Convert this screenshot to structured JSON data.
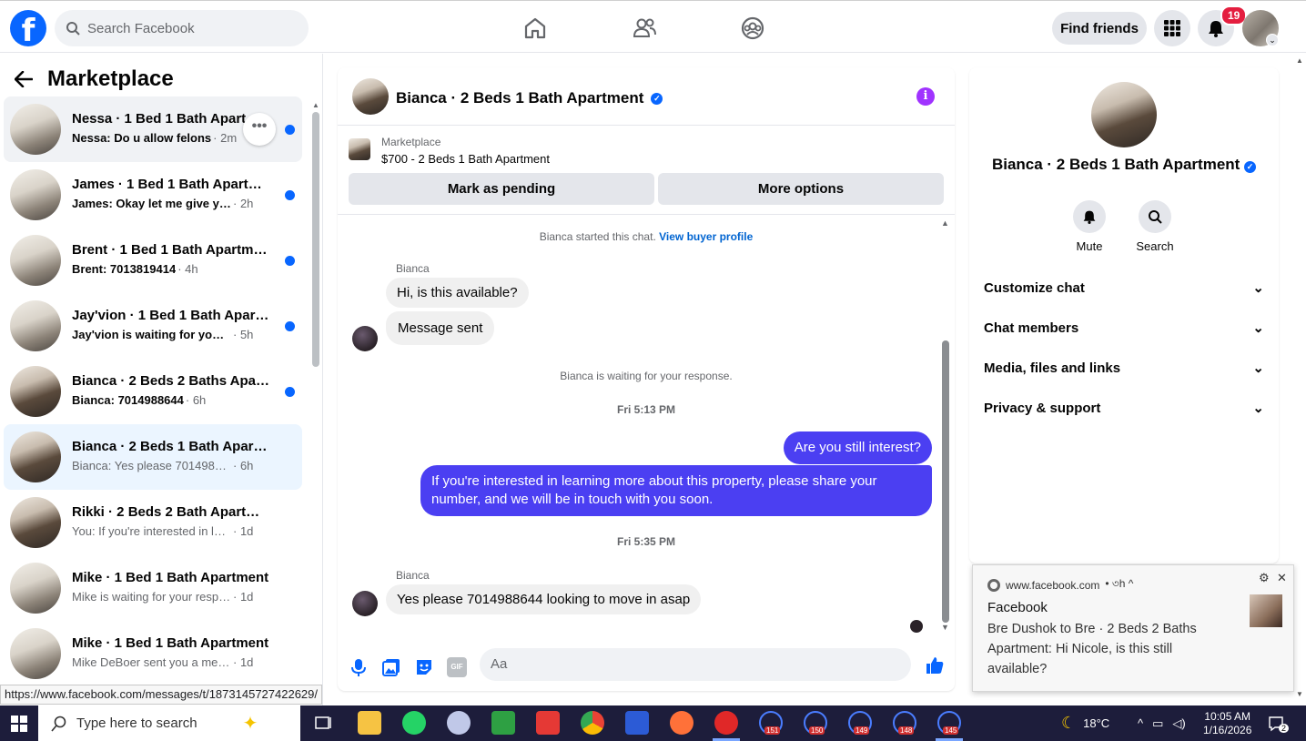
{
  "topbar": {
    "logo": "f",
    "search_placeholder": "Search Facebook",
    "find_friends": "Find friends",
    "notif_count": "19",
    "icons": [
      "home-icon",
      "friends-icon",
      "groups-icon",
      "menu-grid-icon",
      "bell-icon"
    ]
  },
  "left": {
    "title": "Marketplace",
    "more": "•••",
    "conversations": [
      {
        "name": "Nessa · 1 Bed 1 Bath Apartment",
        "preview": "Nessa: Do u allow felons",
        "time": "· 2m",
        "unread": true
      },
      {
        "name": "James · 1 Bed 1 Bath Apartment",
        "preview": "James: Okay let me give you my number",
        "time": "· 2h",
        "unread": true
      },
      {
        "name": "Brent · 1 Bed 1 Bath Apartment",
        "preview": "Brent: 7013819414",
        "time": "· 4h",
        "unread": true
      },
      {
        "name": "Jay'vion · 1 Bed 1 Bath Apartment",
        "preview": "Jay'vion is waiting for your response.",
        "time": "· 5h",
        "unread": true
      },
      {
        "name": "Bianca · 2 Beds 2 Baths Apartment",
        "preview": "Bianca: 7014988644",
        "time": "· 6h",
        "unread": true
      },
      {
        "name": "Bianca · 2 Beds 1 Bath Apartment",
        "preview": "Bianca: Yes please 7014988644 looking to move in asap",
        "time": "· 6h",
        "unread": false
      },
      {
        "name": "Rikki · 2 Beds 2 Bath Apartment",
        "preview": "You: If you're interested in learning more about this property",
        "time": "· 1d",
        "unread": false
      },
      {
        "name": "Mike · 1 Bed 1 Bath Apartment",
        "preview": "Mike is waiting for your response.",
        "time": "· 1d",
        "unread": false
      },
      {
        "name": "Mike · 1 Bed 1 Bath Apartment",
        "preview": "Mike DeBoer sent you a message about your listing",
        "time": "· 1d",
        "unread": false
      }
    ]
  },
  "status_url": "https://www.facebook.com/messages/t/1873145727422629/",
  "chat": {
    "title": "Bianca · 2 Beds 1 Bath Apartment",
    "info": "i",
    "marketplace_label": "Marketplace",
    "listing": "$700 - 2 Beds 1 Bath Apartment",
    "mark_pending": "Mark as pending",
    "more_options": "More options",
    "started_text": "Bianca started this chat.",
    "view_profile": "View buyer profile",
    "sender1": "Bianca",
    "msg1": "Hi, is this available?",
    "msg2": "Message sent",
    "waiting": "Bianca is waiting for your response.",
    "time1": "Fri 5:13 PM",
    "out1": "Are you still interest?",
    "out2": "If you're interested in learning more about this property, please share your number, and we will be in touch with you soon.",
    "time2": "Fri 5:35 PM",
    "sender2": "Bianca",
    "msg3": "Yes please 7014988644 looking to move in asap",
    "composer_placeholder": "Aa",
    "gif": "GIF"
  },
  "details": {
    "name": "Bianca · 2 Beds 1 Bath Apartment",
    "mute": "Mute",
    "search": "Search",
    "sections": [
      "Customize chat",
      "Chat members",
      "Media, files and links",
      "Privacy & support"
    ]
  },
  "notification": {
    "source": "www.facebook.com",
    "age": "• ৩h ^",
    "app": "Facebook",
    "body": "Bre Dushok to Bre · 2 Beds 2 Baths Apartment: Hi Nicole, is this still available?",
    "settings": "⚙",
    "close": "✕"
  },
  "taskbar": {
    "search_placeholder": "Type here to search",
    "badges": [
      "151",
      "150",
      "149",
      "148",
      "145"
    ],
    "weather": "18°C",
    "time": "10:05 AM",
    "date": "1/16/2026",
    "notif_count": "2"
  }
}
